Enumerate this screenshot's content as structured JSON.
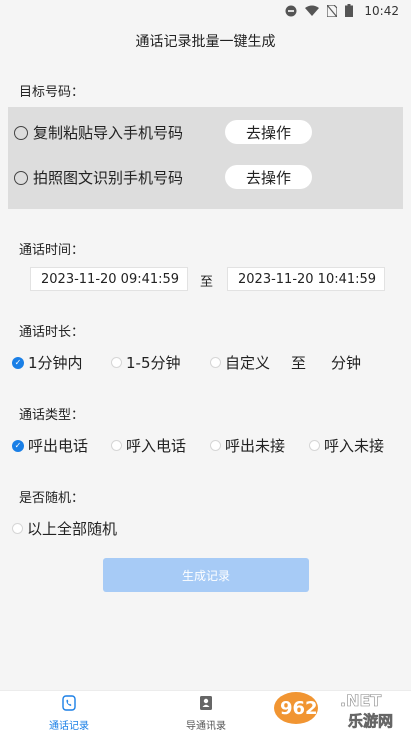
{
  "status_bar": {
    "time": "10:42"
  },
  "page_title": "通话记录批量一键生成",
  "target_number": {
    "label": "目标号码：",
    "options": [
      {
        "label": "复制粘贴导入手机号码",
        "button": "去操作"
      },
      {
        "label": "拍照图文识别手机号码",
        "button": "去操作"
      }
    ]
  },
  "call_time": {
    "label": "通话时间：",
    "start": "2023-11-20 09:41:59",
    "separator": "至",
    "end": "2023-11-20 10:41:59"
  },
  "call_duration": {
    "label": "通话时长：",
    "options": [
      "1分钟内",
      "1-5分钟",
      "自定义"
    ],
    "selected": 0,
    "custom_to": "至",
    "custom_unit": "分钟"
  },
  "call_type": {
    "label": "通话类型：",
    "options": [
      "呼出电话",
      "呼入电话",
      "呼出未接",
      "呼入未接"
    ],
    "selected": 0
  },
  "random": {
    "label": "是否随机：",
    "option": "以上全部随机"
  },
  "generate_button": "生成记录",
  "bottom_nav": [
    {
      "label": "通话记录",
      "icon": "phone-icon",
      "active": true
    },
    {
      "label": "导通讯录",
      "icon": "contacts-icon",
      "active": false
    }
  ],
  "watermark": {
    "brand": "962",
    "suffix": ".NET",
    "text": "乐游网"
  },
  "colors": {
    "accent": "#1a7fe6",
    "button_disabled": "#a7cbf6",
    "panel": "#dddddd"
  }
}
